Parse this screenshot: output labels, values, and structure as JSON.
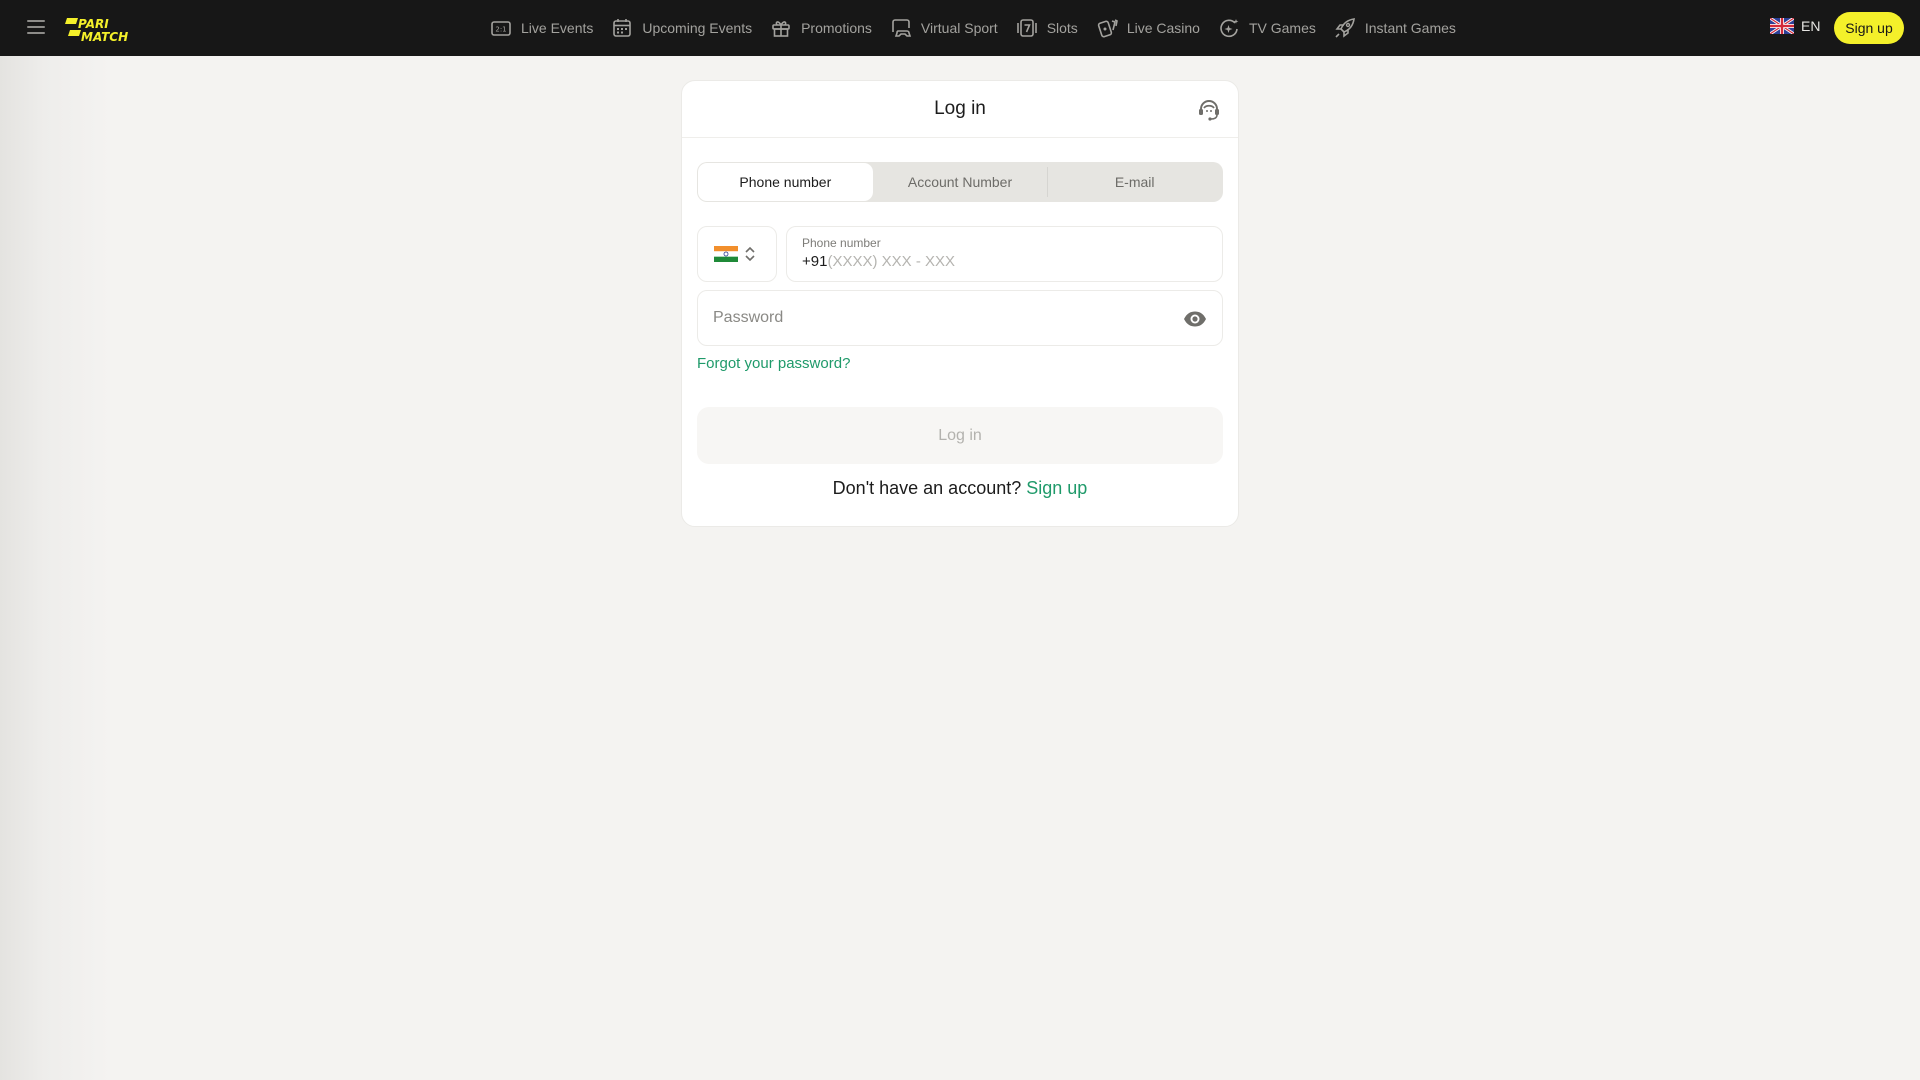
{
  "header": {
    "menu_icon": "hamburger-menu-icon",
    "logo_text": [
      "PARI",
      "MATCH"
    ],
    "nav": [
      {
        "label": "Live Events",
        "icon": "live-score-icon"
      },
      {
        "label": "Upcoming Events",
        "icon": "calendar-icon"
      },
      {
        "label": "Promotions",
        "icon": "gift-icon"
      },
      {
        "label": "Virtual Sport",
        "icon": "virtual-gamepad-icon"
      },
      {
        "label": "Slots",
        "icon": "slot-seven-icon"
      },
      {
        "label": "Live Casino",
        "icon": "playing-cards-icon"
      },
      {
        "label": "TV Games",
        "icon": "sparkle-tv-icon"
      },
      {
        "label": "Instant Games",
        "icon": "rocket-icon"
      }
    ],
    "language": "EN",
    "signup_label": "Sign up",
    "colors": {
      "bg": "#171717",
      "accent": "#f4f02a"
    }
  },
  "login": {
    "title": "Log in",
    "support_icon": "support-headset-icon",
    "tabs": [
      {
        "label": "Phone number",
        "active": true
      },
      {
        "label": "Account Number",
        "active": false
      },
      {
        "label": "E-mail",
        "active": false
      }
    ],
    "country_code_flag": "India",
    "phone": {
      "label": "Phone number",
      "prefix": "+91",
      "placeholder": "(XXXX) XXX - XXX"
    },
    "password": {
      "placeholder": "Password"
    },
    "forgot_label": "Forgot your password?",
    "submit_label": "Log in",
    "no_account_text": "Don't have an account?",
    "signup_link": "Sign up",
    "colors": {
      "link": "#1f9a6a"
    }
  }
}
